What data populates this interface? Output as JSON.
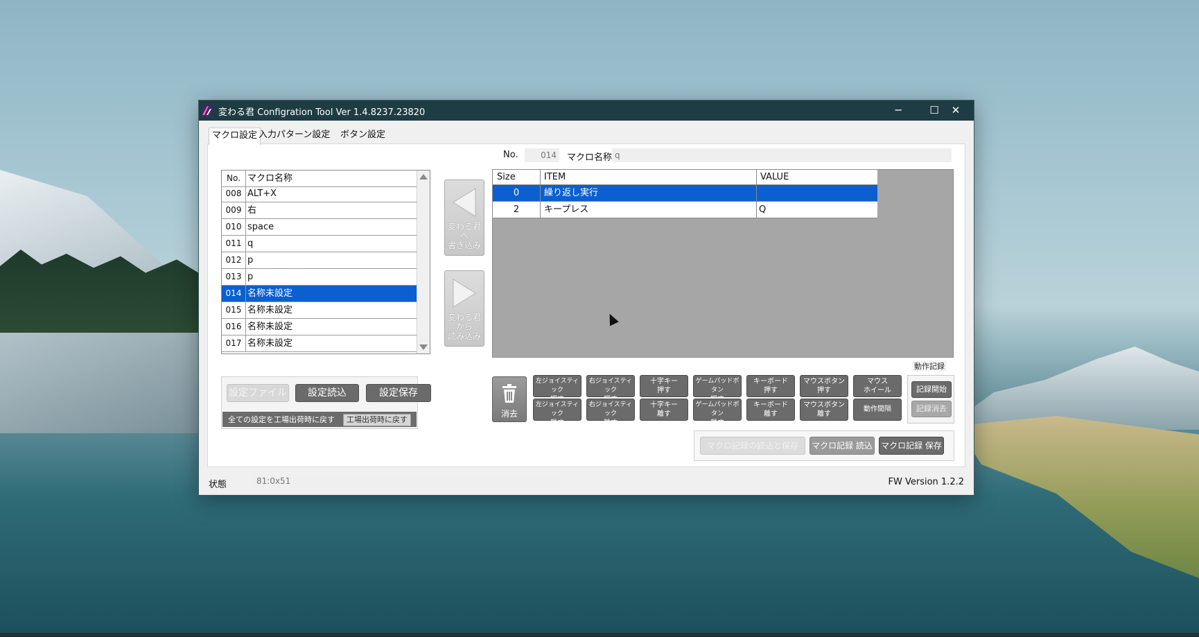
{
  "window": {
    "title": "変わる君 Configration Tool Ver 1.4.8237.23820",
    "minimize_glyph": "─",
    "maximize_glyph": "☐",
    "close_glyph": "✕"
  },
  "tabs": [
    {
      "label": "マクロ設定",
      "active": true
    },
    {
      "label": "入力パターン設定",
      "active": false
    },
    {
      "label": "ボタン設定",
      "active": false
    }
  ],
  "macro_list": {
    "header": {
      "no": "No.",
      "name": "マクロ名称"
    },
    "rows": [
      {
        "no": "008",
        "name": "ALT+X",
        "selected": false
      },
      {
        "no": "009",
        "name": "右",
        "selected": false
      },
      {
        "no": "010",
        "name": "space",
        "selected": false
      },
      {
        "no": "011",
        "name": "q",
        "selected": false
      },
      {
        "no": "012",
        "name": "p",
        "selected": false
      },
      {
        "no": "013",
        "name": "p",
        "selected": false
      },
      {
        "no": "014",
        "name": "名称未設定",
        "selected": true
      },
      {
        "no": "015",
        "name": "名称未設定",
        "selected": false
      },
      {
        "no": "016",
        "name": "名称未設定",
        "selected": false
      },
      {
        "no": "017",
        "name": "名称未設定",
        "selected": false
      }
    ]
  },
  "transfer": {
    "write_label": [
      "変わる君",
      "へ",
      "書き込み"
    ],
    "read_label": [
      "変わる君",
      "から",
      "読み込み"
    ]
  },
  "file_panel": {
    "settings_file": "設定ファイル",
    "load": "設定読込",
    "save": "設定保存",
    "reset_text": "全ての設定を工場出荷時に戻す",
    "reset_button": "工場出荷時に戻す"
  },
  "macro_header": {
    "no_label": "No.",
    "no_value": "014",
    "name_label": "マクロ名称",
    "name_value": "q"
  },
  "grid": {
    "columns": [
      "Size",
      "ITEM",
      "VALUE"
    ],
    "rows": [
      {
        "size": "0",
        "item": "繰り返し実行",
        "value": "",
        "selected": true
      },
      {
        "size": "2",
        "item": "キープレス",
        "value": "Q",
        "selected": false
      }
    ]
  },
  "actions": {
    "trash_label": "消去",
    "press_row": [
      [
        "左ジョイスティック",
        "押す"
      ],
      [
        "右ジョイスティック",
        "押す"
      ],
      [
        "十字キー",
        "押す"
      ],
      [
        "ゲームパッドボタン",
        "押す"
      ],
      [
        "キーボード",
        "押す"
      ],
      [
        "マウスボタン",
        "押す"
      ],
      [
        "マウス",
        "ホイール"
      ]
    ],
    "release_row": [
      [
        "左ジョイスティック",
        "離す"
      ],
      [
        "右ジョイスティック",
        "離す"
      ],
      [
        "十字キー",
        "離す"
      ],
      [
        "ゲームパッドボタン",
        "離す"
      ],
      [
        "キーボード",
        "離す"
      ],
      [
        "マウスボタン",
        "離す"
      ],
      [
        "動作間隔"
      ]
    ]
  },
  "recording": {
    "title": "動作記録",
    "start": "記録開始",
    "clear": "記録消去"
  },
  "macro_record": {
    "load_save": "マクロ記録の読込と保存",
    "load": "マクロ記録 読込",
    "save": "マクロ記録 保存"
  },
  "status": {
    "label": "状態",
    "value": "81:0x51",
    "fw_version": "FW Version 1.2.2"
  },
  "colors": {
    "selection": "#0b5fd0",
    "titlebar": "#1e3c44",
    "button_gray": "#6b6b6b"
  }
}
